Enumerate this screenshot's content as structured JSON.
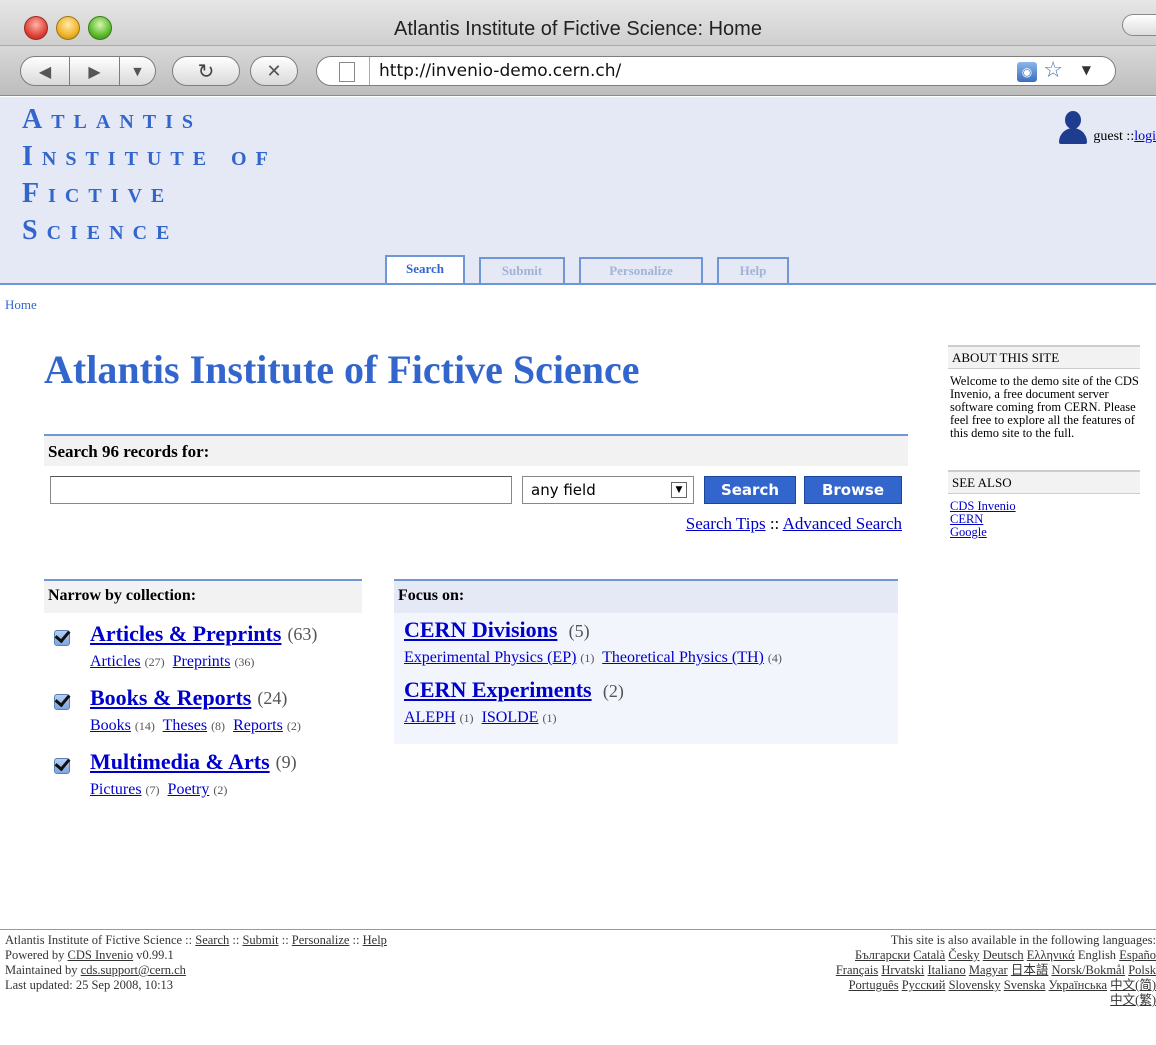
{
  "browser": {
    "window_title": "Atlantis Institute of Fictive Science: Home",
    "url": "http://invenio-demo.cern.ch/"
  },
  "header": {
    "site_name_lines": [
      "Atlantis",
      "Institute of",
      "Fictive",
      "Science"
    ],
    "user": "guest :: ",
    "login_label": "logi",
    "tabs": [
      "Search",
      "Submit",
      "Personalize",
      "Help"
    ]
  },
  "breadcrumb": "Home",
  "page_title": "Atlantis Institute of Fictive Science",
  "search": {
    "header": "Search 96 records for:",
    "query": "",
    "field": "any field",
    "search_button": "Search",
    "browse_button": "Browse",
    "tips": "Search Tips",
    "sep": " :: ",
    "advanced": "Advanced Search"
  },
  "narrow": {
    "header": "Narrow by collection:",
    "collections": [
      {
        "name": "Articles & Preprints",
        "count": "(63)",
        "subs": [
          {
            "name": "Articles",
            "count": "(27)"
          },
          {
            "name": "Preprints",
            "count": "(36)"
          }
        ]
      },
      {
        "name": "Books & Reports",
        "count": "(24)",
        "subs": [
          {
            "name": "Books",
            "count": "(14)"
          },
          {
            "name": "Theses",
            "count": "(8)"
          },
          {
            "name": "Reports",
            "count": "(2)"
          }
        ]
      },
      {
        "name": "Multimedia & Arts",
        "count": "(9)",
        "subs": [
          {
            "name": "Pictures",
            "count": "(7)"
          },
          {
            "name": "Poetry",
            "count": "(2)"
          }
        ]
      }
    ]
  },
  "focus": {
    "header": "Focus on:",
    "groups": [
      {
        "name": "CERN Divisions",
        "count": "(5)",
        "subs": [
          {
            "name": "Experimental Physics (EP)",
            "count": "(1)"
          },
          {
            "name": "Theoretical Physics (TH)",
            "count": "(4)"
          }
        ]
      },
      {
        "name": "CERN Experiments",
        "count": "(2)",
        "subs": [
          {
            "name": "ALEPH",
            "count": "(1)"
          },
          {
            "name": "ISOLDE",
            "count": "(1)"
          }
        ]
      }
    ]
  },
  "sidebar": {
    "about_title": "ABOUT THIS SITE",
    "about_text": "Welcome to the demo site of the CDS Invenio, a free document server software coming from CERN. Please feel free to explore all the features of this demo site to the full.",
    "see_also_title": "SEE ALSO",
    "links": [
      "CDS Invenio",
      "CERN",
      "Google"
    ]
  },
  "footer": {
    "line1_prefix": "Atlantis Institute of Fictive Science :: ",
    "line1_links": [
      "Search",
      "Submit",
      "Personalize",
      "Help"
    ],
    "powered_prefix": "Powered by ",
    "powered_link": "CDS Invenio",
    "powered_suffix": " v0.99.1",
    "maintained_prefix": "Maintained by ",
    "maintained_link": "cds.support@cern.ch",
    "updated": "Last updated: 25 Sep 2008, 10:13",
    "languages_intro": "This site is also available in the following languages:",
    "languages": [
      "Български",
      "Català",
      "Česky",
      "Deutsch",
      "Ελληνικά",
      "English",
      "Españo",
      "Français",
      "Hrvatski",
      "Italiano",
      "Magyar",
      "日本語",
      "Norsk/Bokmål",
      "Polsk",
      "Português",
      "Русский",
      "Slovensky",
      "Svenska",
      "Українська",
      "中文(简)",
      "中文(繁)"
    ]
  }
}
